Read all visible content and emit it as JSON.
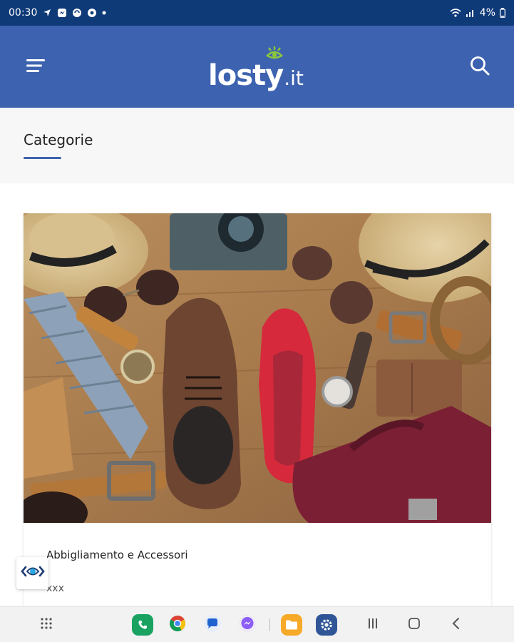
{
  "status_bar": {
    "time": "00:30",
    "battery": "4%",
    "icons": [
      "navigation-icon",
      "messenger-small-icon",
      "app-notification-icon",
      "vodafone-icon",
      "dot-icon",
      "wifi-icon",
      "signal-icon",
      "battery-icon"
    ]
  },
  "header": {
    "logo_main": "losty",
    "logo_tld": ".it",
    "menu_icon": "hamburger-menu-icon",
    "search_icon": "search-icon"
  },
  "tabs": {
    "active_label": "Categorie"
  },
  "card": {
    "title": "Abbigliamento e Accessori",
    "subtitle": "xxx",
    "image_description": "clothing-and-accessories-photo"
  },
  "fab": {
    "icon": "accessibility-eye-icon"
  },
  "nav_bar": {
    "apps": [
      "phone-app-icon",
      "chrome-app-icon",
      "messages-app-icon",
      "messenger-app-icon",
      "files-app-icon",
      "settings-app-icon"
    ],
    "buttons": [
      "app-drawer-icon",
      "recents-icon",
      "home-icon",
      "back-icon"
    ]
  },
  "colors": {
    "status_bar": "#0f3a78",
    "header": "#3d63b0",
    "accent": "#3d63b0",
    "logo_eye": "#8cc63f"
  }
}
